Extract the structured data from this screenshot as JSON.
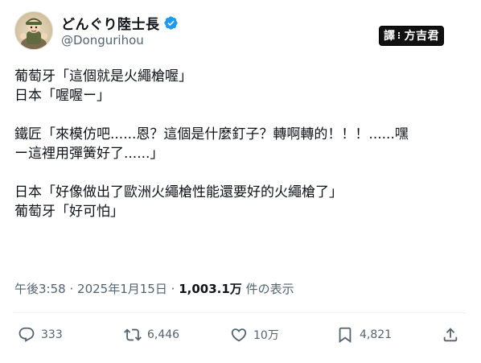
{
  "author": {
    "display_name": "どんぐり陸士長",
    "handle": "@Donguri­hou",
    "verified": true,
    "avatar_icon": "avatar-soldier-icon"
  },
  "watermark": {
    "left": "譯",
    "right": "方吉君"
  },
  "tweet": {
    "lines": [
      "葡萄牙「這個就是火繩槍喔」",
      "日本「喔喔ー」",
      "",
      "鐵匠「來模仿吧......恩？這個是什麼釘子？轉啊轉的！！！......嘿",
      "ー這裡用彈簧好了......」",
      "",
      "日本「好像做出了歐洲火繩槍性能還要好的火繩槍了」",
      "葡萄牙「好可怕」"
    ],
    "time": "午後3:58",
    "date": "2025年1月15日",
    "sep": "·",
    "views": "1,003.1万",
    "views_label": "件の表示"
  },
  "actions": {
    "reply_count": "333",
    "retweet_count": "6,446",
    "like_count": "10万",
    "bookmark_count": "4,821",
    "icons": [
      "reply-icon",
      "retweet-icon",
      "like-icon",
      "bookmark-icon",
      "share-icon"
    ]
  },
  "colors": {
    "text": "#0f1419",
    "secondary": "#536471",
    "verified": "#1d9bf0"
  }
}
